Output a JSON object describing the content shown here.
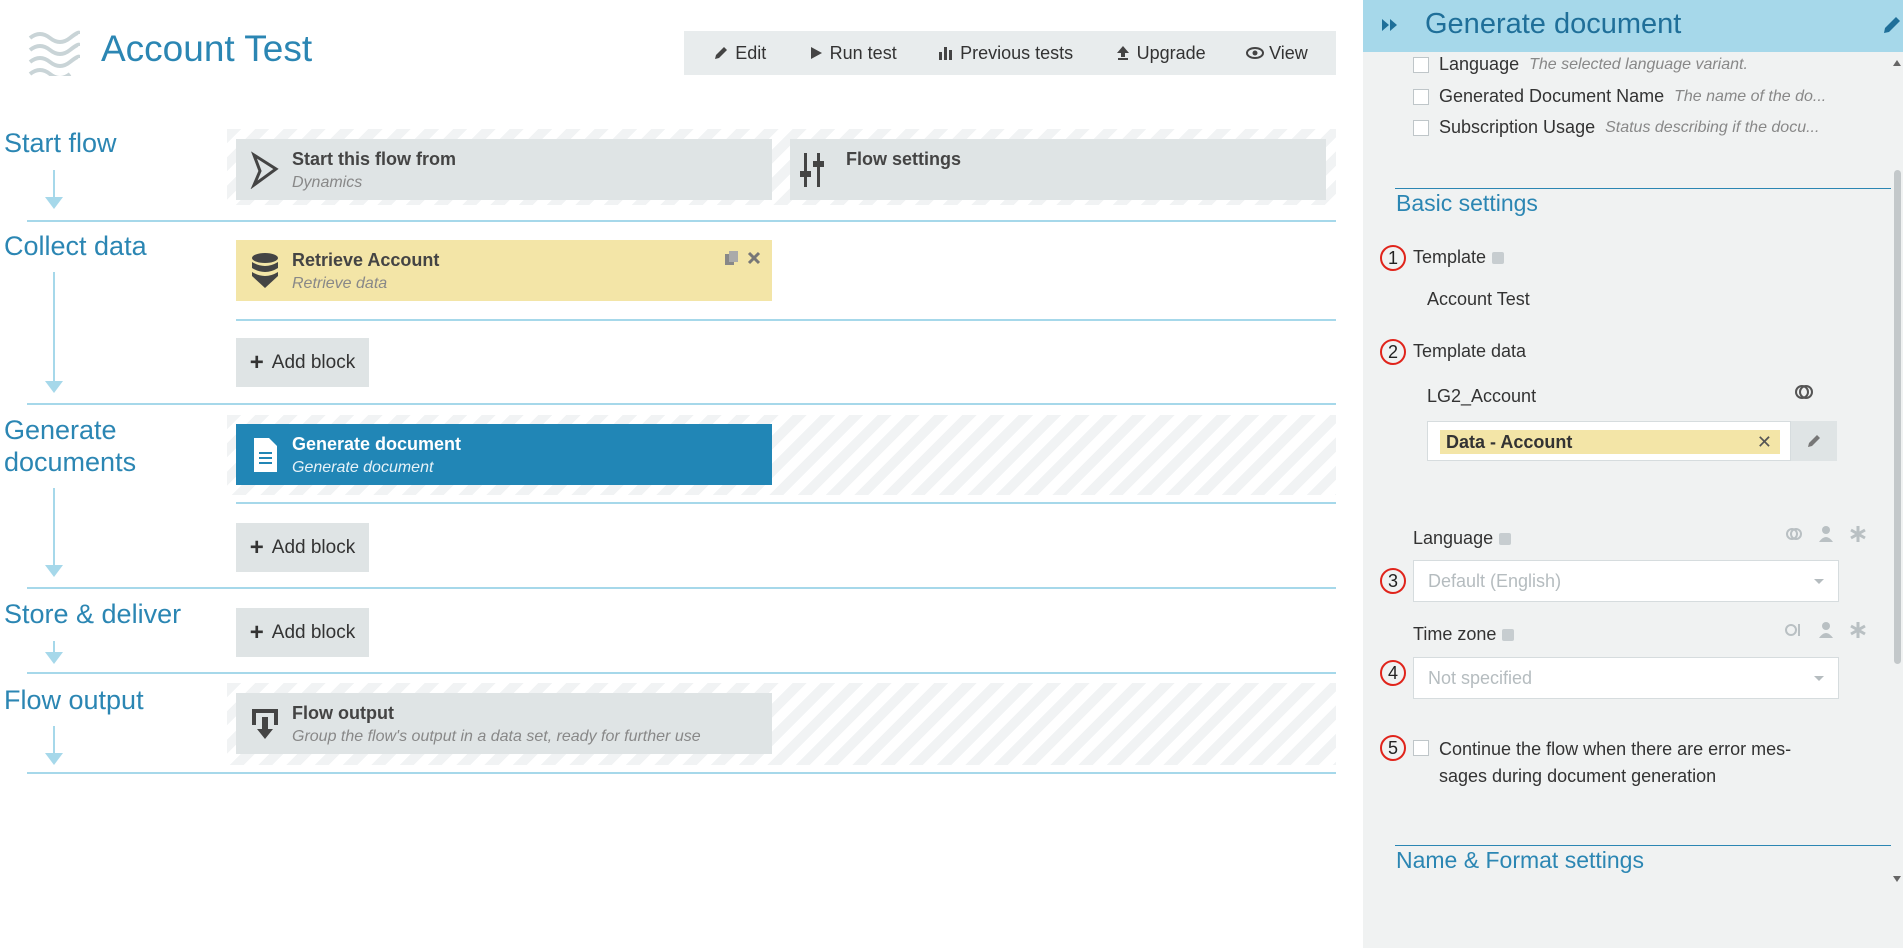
{
  "app": {
    "title": "Account Test"
  },
  "toolbar": {
    "edit": "Edit",
    "run_test": "Run test",
    "previous_tests": "Previous tests",
    "upgrade": "Upgrade",
    "view": "View"
  },
  "stages": {
    "start_flow": {
      "title": "Start flow",
      "blocks": [
        {
          "title": "Start this flow from",
          "subtitle": "Dynamics",
          "icon": "dynamics-icon"
        },
        {
          "title": "Flow settings",
          "subtitle": "",
          "icon": "sliders-icon"
        }
      ]
    },
    "collect_data": {
      "title": "Collect data",
      "block": {
        "title": "Retrieve Account",
        "subtitle": "Retrieve data",
        "icon": "database-icon"
      },
      "add_block": "Add block"
    },
    "generate_documents": {
      "title": "Generate documents",
      "block": {
        "title": "Generate document",
        "subtitle": "Generate document",
        "icon": "document-icon"
      },
      "add_block": "Add block"
    },
    "store_deliver": {
      "title": "Store & deliver",
      "add_block": "Add block"
    },
    "flow_output": {
      "title": "Flow output",
      "block": {
        "title": "Flow output",
        "subtitle": "Group the flow's output in a data set, ready for further use",
        "icon": "output-icon"
      }
    }
  },
  "panel": {
    "title": "Generate document",
    "outputs": [
      {
        "name": "Language",
        "desc": "The selected language variant."
      },
      {
        "name": "Generated Document Name",
        "desc": "The name of the do..."
      },
      {
        "name": "Subscription Usage",
        "desc": "Status describing if the docu..."
      }
    ],
    "basic_settings": "Basic settings",
    "template_label": "Template",
    "template_value": "Account Test",
    "template_data_label": "Template data",
    "template_data_source": "LG2_Account",
    "template_data_tag": "Data - Account",
    "language_label": "Language",
    "language_placeholder": "Default (English)",
    "timezone_label": "Time zone",
    "timezone_placeholder": "Not specified",
    "continue_label": "Continue the flow when there are error mes-sages during document generation",
    "name_format_settings": "Name & Format settings",
    "markers": [
      "1",
      "2",
      "3",
      "4",
      "5"
    ]
  },
  "colors": {
    "accent": "#2b86b3",
    "panel_header": "#a6d8ea",
    "block_grey": "#dfe4e5",
    "block_yellow": "#f3e5a7",
    "block_blue": "#2186b6",
    "marker_red": "#e0241b"
  }
}
